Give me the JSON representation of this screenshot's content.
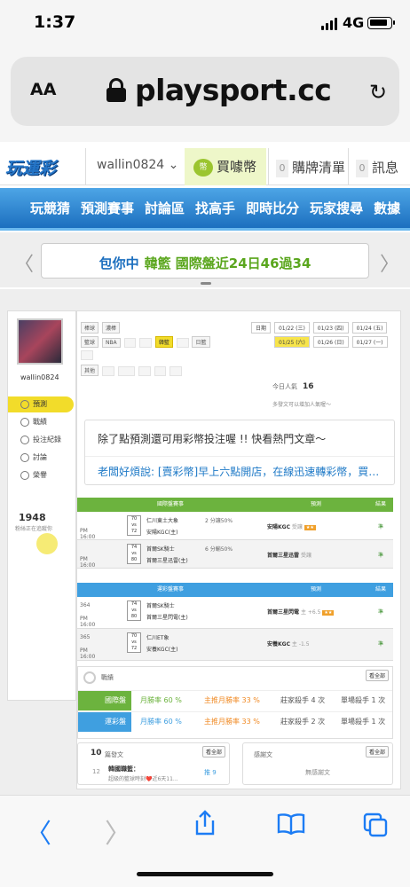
{
  "status": {
    "time": "1:37",
    "network": "4G"
  },
  "browser": {
    "text_size": "AA",
    "url": "playsport.cc"
  },
  "site": {
    "logo": "玩運彩",
    "username": "wallin0824",
    "coin_label": "買噱幣",
    "cart_count": "0",
    "cart_label": "購牌清單",
    "msg_count": "0",
    "msg_label": "訊息"
  },
  "main_nav": [
    "玩競猜",
    "預測賽事",
    "討論區",
    "找高手",
    "即時比分",
    "玩家搜尋",
    "數據"
  ],
  "announce": {
    "part1": "包你中",
    "part2": "韓籃 國際盤近24日46過34"
  },
  "sidebar": {
    "username": "wallin0824",
    "items": [
      "預測",
      "戰績",
      "投注紀錄",
      "討論",
      "榮譽"
    ],
    "fans_count": "1948",
    "fans_text": "粉絲正在追蹤你"
  },
  "filters": {
    "row1_label": "棒球",
    "row1_tags": [
      "濃棒"
    ],
    "row2_label": "籃球",
    "row2_tags": [
      "NBA",
      "韓籃",
      "日籃"
    ],
    "row4_label": "其他",
    "date_label": "日期",
    "dates": [
      "01/22 (三)",
      "01/23 (四)",
      "01/24 (五)",
      "01/25 (六)",
      "01/26 (日)",
      "01/27 (一)"
    ]
  },
  "popularity": {
    "label": "今日人氣",
    "value": "16",
    "tip": "多發文可以增加人氣喔～"
  },
  "note": {
    "line1": "除了點預測還可用彩幣投注喔 !! 快看熱門文章～",
    "line2": "老闆好煩說: [賣彩幣]早上六點開店，在線迅速轉彩幣，買…"
  },
  "intl_table": {
    "headers": [
      "國際盤賽事",
      "預測",
      "結果"
    ],
    "rows": [
      {
        "time": "PM 16:00",
        "score_a": "70",
        "score_b": "72",
        "team_a": "仁川東土大象",
        "team_b": "安陽KGC(主)",
        "odds": "2 分讓50%",
        "pick": "安陽KGC",
        "pick_note": "受讓",
        "result": "準"
      },
      {
        "time": "PM 16:00",
        "score_a": "74",
        "score_b": "80",
        "team_a": "首爾SK騎士",
        "team_b": "首爾三星迅雷(主)",
        "odds": "6 分輸50%",
        "pick": "首爾三星迅雷",
        "pick_note": "受讓",
        "result": "準"
      }
    ]
  },
  "lottery_table": {
    "headers": [
      "運彩盤賽事",
      "預測",
      "結果"
    ],
    "rows": [
      {
        "no": "364",
        "time": "PM 16:00",
        "score_a": "74",
        "score_b": "80",
        "team_a": "首爾SK騎士",
        "team_b": "首爾三星閃電(主)",
        "pick": "首爾三星閃電",
        "pick_note": "主 +6.5",
        "result": "準"
      },
      {
        "no": "365",
        "time": "PM 16:00",
        "score_a": "70",
        "score_b": "72",
        "team_a": "仁川ET象",
        "team_b": "安養KGC(主)",
        "pick": "安養KGC",
        "pick_note": "主 -1.5",
        "result": "準"
      }
    ]
  },
  "record": {
    "title": "戰績",
    "see_all": "看全部",
    "rows": [
      {
        "label": "國際盤",
        "c1": "月勝率 60 %",
        "c2": "主推月勝率 33 %",
        "c3": "莊家殺手 4 次",
        "c4": "單場殺手 1 次"
      },
      {
        "label": "運彩盤",
        "c1": "月勝率 60 %",
        "c2": "主推月勝率 33 %",
        "c3": "莊家殺手 2 次",
        "c4": "單場殺手 1 次"
      }
    ]
  },
  "posts": {
    "count": "10",
    "label": "篇發文",
    "see_all": "看全部",
    "item_no": "12",
    "item_title": "韓國職籃：",
    "item_sub": "超級的籃球時刻❤️近6天11...",
    "push": "推 9"
  },
  "replies": {
    "label": "感謝文",
    "see_all": "看全部",
    "empty": "無感謝文"
  },
  "colors": {
    "green": "#6cb33e",
    "blue": "#3f9fe0",
    "yellow": "#f2dc2a"
  }
}
